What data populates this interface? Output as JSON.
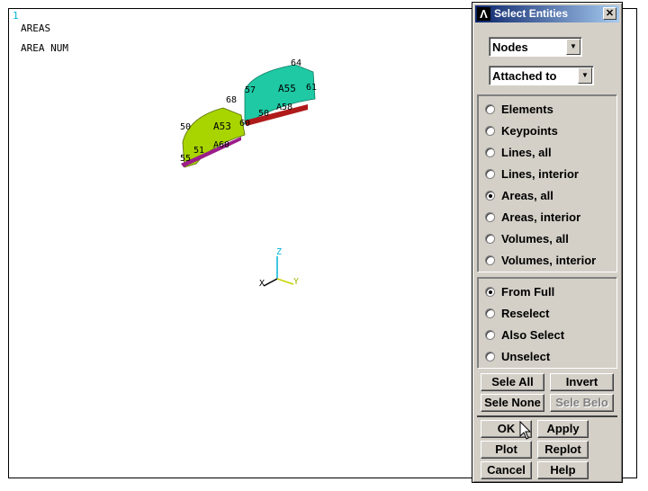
{
  "viewport": {
    "window_number": "1",
    "label_line1": "AREAS",
    "label_line2": "AREA NUM",
    "keypoint_labels": [
      "50",
      "68",
      "57",
      "64",
      "61",
      "55",
      "51",
      "50",
      "60",
      "58"
    ],
    "area_labels": [
      "A53",
      "A55"
    ],
    "line_labels": [
      "A60",
      "A58"
    ],
    "triad": {
      "z": "Z",
      "x": "X",
      "y": "Y"
    },
    "colors": {
      "area_a53": "#a8d400",
      "area_a55": "#1ec9a4",
      "edge_a53": "#9b1d8a",
      "edge_a55": "#b01a1a",
      "triad_z": "#00b4d8",
      "triad_y": "#c8d400"
    }
  },
  "dialog": {
    "title": "Select Entities",
    "close_glyph": "✕",
    "logo_glyph": "Λ",
    "entity_combo": "Nodes",
    "criterion_combo": "Attached to",
    "attach_options": [
      {
        "label": "Elements",
        "selected": false
      },
      {
        "label": "Keypoints",
        "selected": false
      },
      {
        "label": "Lines, all",
        "selected": false
      },
      {
        "label": "Lines, interior",
        "selected": false
      },
      {
        "label": "Areas, all",
        "selected": true
      },
      {
        "label": "Areas, interior",
        "selected": false
      },
      {
        "label": "Volumes, all",
        "selected": false
      },
      {
        "label": "Volumes, interior",
        "selected": false
      }
    ],
    "select_mode": [
      {
        "label": "From Full",
        "selected": true
      },
      {
        "label": "Reselect",
        "selected": false
      },
      {
        "label": "Also Select",
        "selected": false
      },
      {
        "label": "Unselect",
        "selected": false
      }
    ],
    "buttons": {
      "sele_all": "Sele All",
      "invert": "Invert",
      "sele_none": "Sele None",
      "sele_belo": "Sele Belo",
      "ok": "OK",
      "apply": "Apply",
      "plot": "Plot",
      "replot": "Replot",
      "cancel": "Cancel",
      "help": "Help"
    }
  }
}
